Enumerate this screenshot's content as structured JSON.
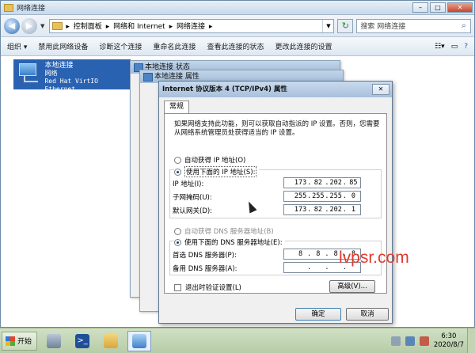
{
  "window": {
    "title": "网络连接",
    "buttons": {
      "minimize": "–",
      "maximize": "□",
      "close": "✕"
    }
  },
  "address": {
    "crumbs": [
      "控制面板",
      "网络和 Internet",
      "网络连接"
    ],
    "separator": "▸"
  },
  "search": {
    "placeholder": "搜索 网络连接"
  },
  "toolbar": {
    "items": [
      "组织 ▾",
      "禁用此网络设备",
      "诊断这个连接",
      "重命名此连接",
      "查看此连接的状态",
      "更改此连接的设置"
    ]
  },
  "connection": {
    "name": "本地连接",
    "network": "网络",
    "adapter": "Red Hat VirtIO Ethernet"
  },
  "bg_dialogs": {
    "status": "本地连接 状态",
    "props": "本地连接 属性"
  },
  "dialog": {
    "title": "Internet 协议版本 4 (TCP/IPv4) 属性",
    "close": "✕",
    "tab": "常规",
    "description": "如果网络支持此功能，则可以获取自动指派的 IP 设置。否则，您需要从网络系统管理员处获得适当的 IP 设置。",
    "auto_ip": "自动获得 IP 地址(O)",
    "manual_ip": "使用下面的 IP 地址(S):",
    "ip_label": "IP 地址(I):",
    "ip": [
      "173",
      "82",
      "202",
      "85"
    ],
    "mask_label": "子网掩码(U):",
    "mask": [
      "255",
      "255",
      "255",
      "0"
    ],
    "gw_label": "默认网关(D):",
    "gw": [
      "173",
      "82",
      "202",
      "1"
    ],
    "auto_dns": "自动获得 DNS 服务器地址(B)",
    "manual_dns": "使用下面的 DNS 服务器地址(E):",
    "dns1_label": "首选 DNS 服务器(P):",
    "dns1": [
      "8",
      "8",
      "8",
      "8"
    ],
    "dns2_label": "备用 DNS 服务器(A):",
    "dns2": [
      "",
      "",
      "",
      ""
    ],
    "validate": "退出时验证设置(L)",
    "advanced": "高级(V)...",
    "ok": "确定",
    "cancel": "取消"
  },
  "watermark": "lvpsr.com",
  "taskbar": {
    "start": "开始",
    "time": "6:30",
    "date": "2020/8/7"
  }
}
